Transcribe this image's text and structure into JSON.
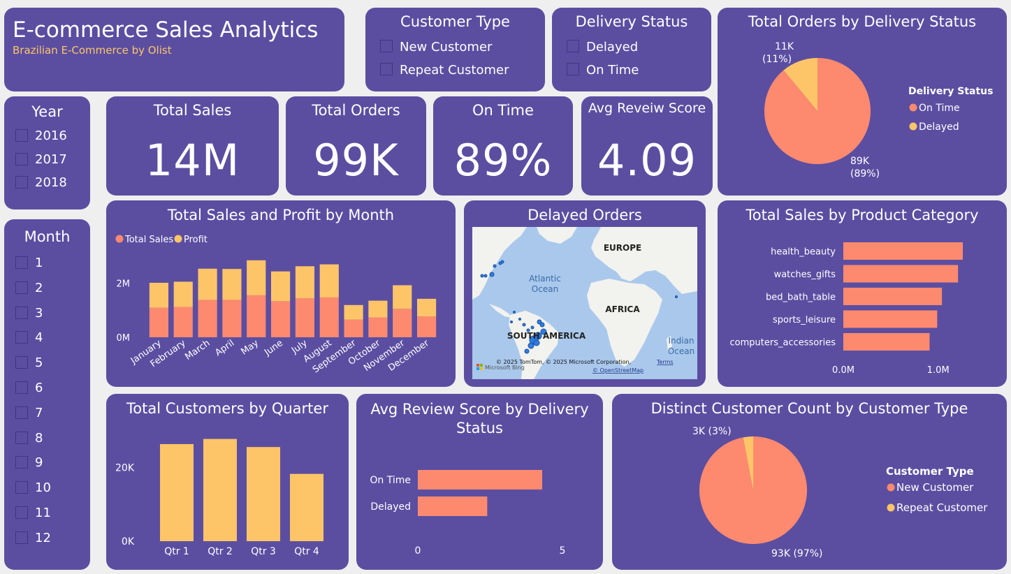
{
  "colors": {
    "card": "#5b4ea1",
    "primary": "#fd8a6f",
    "secondary": "#fdc567",
    "background": "#efefef",
    "ocean": "#a9c8ec",
    "land": "#f2f2ee"
  },
  "header": {
    "title": "E-commerce Sales Analytics",
    "subtitle": "Brazilian E-Commerce by Olist"
  },
  "filters": {
    "customer_type": {
      "title": "Customer Type",
      "options": [
        "New Customer",
        "Repeat Customer"
      ]
    },
    "delivery_status": {
      "title": "Delivery Status",
      "options": [
        "Delayed",
        "On Time"
      ]
    },
    "year": {
      "title": "Year",
      "options": [
        "2016",
        "2017",
        "2018"
      ]
    },
    "month": {
      "title": "Month",
      "options": [
        "1",
        "2",
        "3",
        "4",
        "5",
        "6",
        "7",
        "8",
        "9",
        "10",
        "11",
        "12"
      ]
    }
  },
  "kpis": {
    "total_sales": {
      "title": "Total Sales",
      "value": "14M"
    },
    "total_orders": {
      "title": "Total Orders",
      "value": "99K"
    },
    "on_time": {
      "title": "On Time",
      "value": "89%"
    },
    "avg_review": {
      "title": "Avg Reveiw Score",
      "value": "4.09"
    }
  },
  "map": {
    "title": "Delayed Orders",
    "labels": {
      "europe": "EUROPE",
      "africa": "AFRICA",
      "south_america": "SOUTH AMERICA",
      "atlantic": "Atlantic Ocean",
      "indian": "Indian Ocean"
    },
    "attribution": "© 2025 TomTom, © 2025 Microsoft Corporation,",
    "terms": "Terms",
    "osm": "© OpenStreetMap",
    "bing": "Microsoft Bing"
  },
  "chart_data": [
    {
      "id": "orders_by_delivery",
      "type": "pie",
      "title": "Total Orders by Delivery Status",
      "legend_title": "Delivery Status",
      "legend_position": "right",
      "slices": [
        {
          "name": "On Time",
          "value": 89,
          "label": "89K",
          "pct": "(89%)",
          "color": "#fd8a6f"
        },
        {
          "name": "Delayed",
          "value": 11,
          "label": "11K",
          "pct": "(11%)",
          "color": "#fdc567"
        }
      ]
    },
    {
      "id": "sales_profit_by_month",
      "type": "bar",
      "stacked": true,
      "title": "Total Sales and Profit by Month",
      "legend_position": "top-left",
      "categories": [
        "January",
        "February",
        "March",
        "April",
        "May",
        "June",
        "July",
        "August",
        "September",
        "October",
        "November",
        "December"
      ],
      "series": [
        {
          "name": "Total Sales",
          "color": "#fd8a6f",
          "values": [
            1.09,
            1.12,
            1.38,
            1.38,
            1.55,
            1.33,
            1.44,
            1.47,
            0.65,
            0.73,
            1.05,
            0.77
          ]
        },
        {
          "name": "Profit",
          "color": "#fdc567",
          "values": [
            0.92,
            0.93,
            1.15,
            1.14,
            1.29,
            1.1,
            1.18,
            1.22,
            0.54,
            0.62,
            0.87,
            0.65
          ]
        }
      ],
      "yticks": [
        {
          "v": 0,
          "label": "0M"
        },
        {
          "v": 2,
          "label": "2M"
        }
      ],
      "ylim": [
        0,
        3.4
      ]
    },
    {
      "id": "sales_by_category",
      "type": "bar",
      "orientation": "horizontal",
      "title": "Total Sales by Product Category",
      "categories": [
        "health_beauty",
        "watches_gifts",
        "bed_bath_table",
        "sports_leisure",
        "computers_accessories"
      ],
      "values": [
        1.26,
        1.21,
        1.04,
        0.99,
        0.91
      ],
      "color": "#fd8a6f",
      "xticks": [
        {
          "v": 0,
          "label": "0.0M"
        },
        {
          "v": 1,
          "label": "1.0M"
        }
      ],
      "xlim": [
        0,
        1.26
      ]
    },
    {
      "id": "customers_by_quarter",
      "type": "bar",
      "title": "Total Customers by Quarter",
      "categories": [
        "Qtr 1",
        "Qtr 2",
        "Qtr 3",
        "Qtr 4"
      ],
      "values": [
        26400,
        27800,
        25600,
        18300
      ],
      "color": "#fdc567",
      "yticks": [
        {
          "v": 0,
          "label": "0K"
        },
        {
          "v": 20000,
          "label": "20K"
        }
      ],
      "ylim": [
        0,
        30000
      ]
    },
    {
      "id": "review_by_delivery",
      "type": "bar",
      "orientation": "horizontal",
      "title": "Avg Review Score by Delivery Status",
      "categories": [
        "On Time",
        "Delayed"
      ],
      "values": [
        4.3,
        2.4
      ],
      "color": "#fd8a6f",
      "xticks": [
        {
          "v": 0,
          "label": "0"
        },
        {
          "v": 5,
          "label": "5"
        }
      ],
      "xlim": [
        0,
        5
      ]
    },
    {
      "id": "customers_by_type",
      "type": "pie",
      "title": "Distinct Customer Count by Customer Type",
      "legend_title": "Customer Type",
      "legend_position": "right",
      "slices": [
        {
          "name": "New Customer",
          "value": 97,
          "label": "93K (97%)",
          "color": "#fd8a6f"
        },
        {
          "name": "Repeat Customer",
          "value": 3,
          "label": "3K (3%)",
          "color": "#fdc567"
        }
      ]
    }
  ]
}
